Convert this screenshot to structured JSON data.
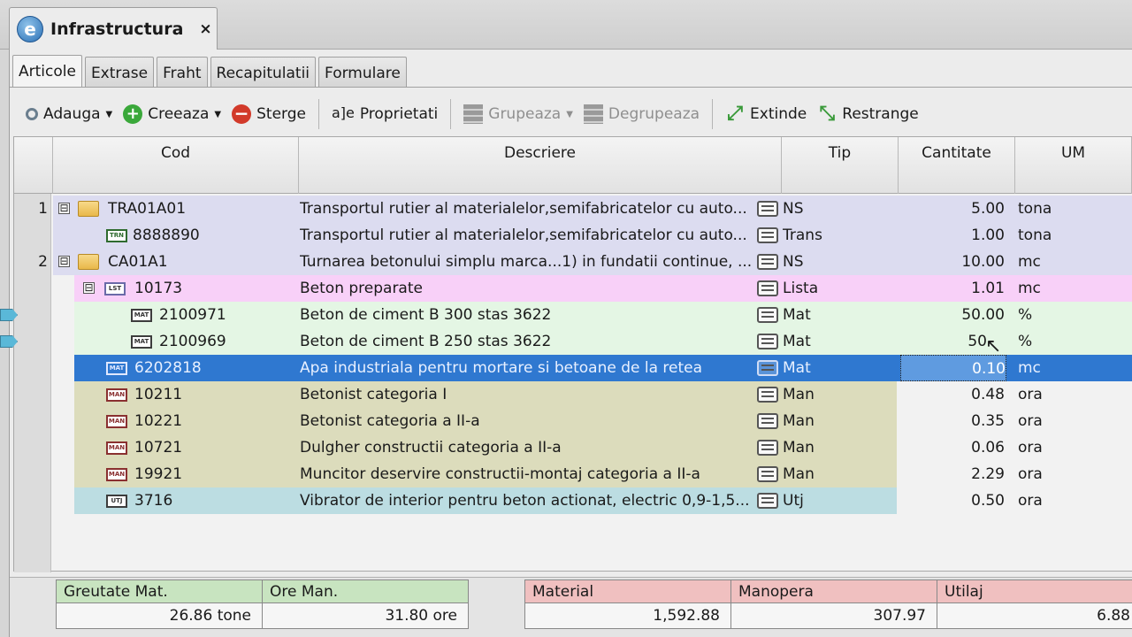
{
  "window_tab": {
    "title": "Infrastructura",
    "close": "×",
    "icon": "e"
  },
  "subtabs": [
    "Articole",
    "Extrase",
    "Fraht",
    "Recapitulatii",
    "Formulare"
  ],
  "toolbar": {
    "add": "Adauga",
    "create": "Creeaza",
    "delete": "Sterge",
    "properties": "Proprietati",
    "properties_icon_text": "a]e",
    "group": "Grupeaza",
    "ungroup": "Degrupeaza",
    "expand": "Extinde",
    "collapse": "Restrange"
  },
  "columns": {
    "cod": "Cod",
    "descriere": "Descriere",
    "tip": "Tip",
    "cantitate": "Cantitate",
    "um": "UM"
  },
  "rows": [
    {
      "num": "1",
      "cod": "TRA01A01",
      "desc": "Transportul rutier al materialelor,semifabricatelor cu auto...",
      "tip": "NS",
      "cant": "5.00",
      "um": "tona"
    },
    {
      "num": "",
      "cod": "8888890",
      "desc": "Transportul rutier al materialelor,semifabricatelor cu auto...",
      "tip": "Trans",
      "cant": "1.00",
      "um": "tona"
    },
    {
      "num": "2",
      "cod": "CA01A1",
      "desc": "Turnarea betonului simplu marca...1) in fundatii continue, ...",
      "tip": "NS",
      "cant": "10.00",
      "um": "mc"
    },
    {
      "num": "",
      "cod": "10173",
      "desc": "Beton preparate",
      "tip": "Lista",
      "cant": "1.01",
      "um": "mc"
    },
    {
      "num": "",
      "cod": "2100971",
      "desc": "Beton de ciment   B 300   stas  3622",
      "tip": "Mat",
      "cant": "50.00",
      "um": "%"
    },
    {
      "num": "",
      "cod": "2100969",
      "desc": "Beton de ciment   B 250   stas  3622",
      "tip": "Mat",
      "cant": "50",
      "um": "%"
    },
    {
      "num": "",
      "cod": "6202818",
      "desc": "Apa industriala pentru mortare si betoane de la retea",
      "tip": "Mat",
      "cant": "0.10",
      "um": "mc"
    },
    {
      "num": "",
      "cod": "10211",
      "desc": "Betonist categoria I",
      "tip": "Man",
      "cant": "0.48",
      "um": "ora"
    },
    {
      "num": "",
      "cod": "10221",
      "desc": "Betonist categoria a II-a",
      "tip": "Man",
      "cant": "0.35",
      "um": "ora"
    },
    {
      "num": "",
      "cod": "10721",
      "desc": "Dulgher constructii categoria a II-a",
      "tip": "Man",
      "cant": "0.06",
      "um": "ora"
    },
    {
      "num": "",
      "cod": "19921",
      "desc": "Muncitor deservire constructii-montaj categoria a II-a",
      "tip": "Man",
      "cant": "2.29",
      "um": "ora"
    },
    {
      "num": "",
      "cod": "3716",
      "desc": "Vibrator de interior pentru beton actionat, electric 0,9-1,5...",
      "tip": "Utj",
      "cant": "0.50",
      "um": "ora"
    }
  ],
  "tree_toggle": "⊟",
  "summary": {
    "greutate_label": "Greutate Mat.",
    "greutate_value": "26.86 tone",
    "ore_label": "Ore Man.",
    "ore_value": "31.80 ore",
    "material_label": "Material",
    "material_value": "1,592.88",
    "manopera_label": "Manopera",
    "manopera_value": "307.97",
    "utilaj_label": "Utilaj",
    "utilaj_value": "6.88"
  },
  "colors": {
    "ns_row": "#dcdcf0",
    "lista_row": "#f8d0f8",
    "mat_row": "#e4f6e4",
    "man_row": "#dcdcbc",
    "utj_row": "#bcdde2",
    "selected_row": "#2f78d0",
    "sum_green": "#c8e4c0",
    "sum_red": "#f0c0c0"
  }
}
